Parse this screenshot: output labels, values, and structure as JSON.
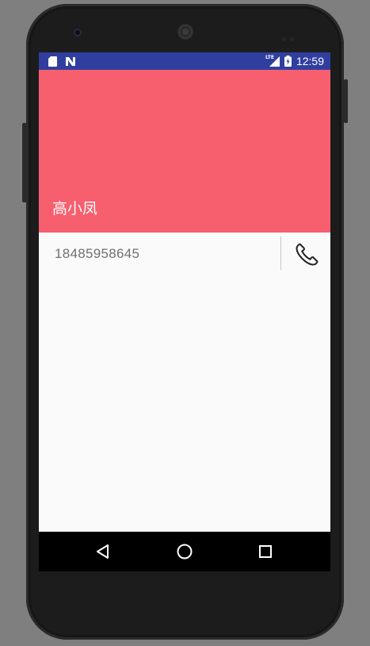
{
  "status_bar": {
    "time": "12:59",
    "left_icons": [
      "sd-card-icon",
      "notification-n-icon"
    ],
    "right_icons": [
      "lte-signal-icon",
      "battery-icon"
    ],
    "network_label": "LTE",
    "background_color": "#303f9f"
  },
  "contact": {
    "name": "高小凤",
    "phone": "18485958645",
    "header_color": "#f75f6e"
  },
  "actions": {
    "call_icon": "phone-icon"
  },
  "navigation_bar": {
    "buttons": [
      "back-icon",
      "home-icon",
      "recents-icon"
    ]
  }
}
